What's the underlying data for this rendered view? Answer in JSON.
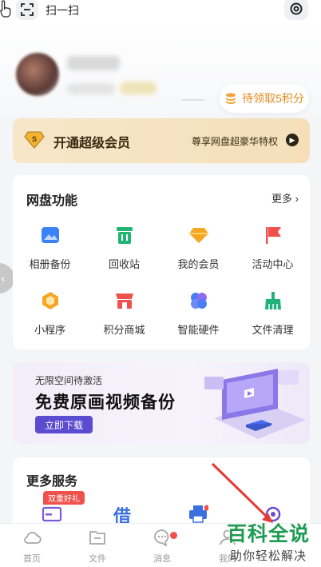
{
  "header": {
    "scan_label": "扫一扫"
  },
  "profile": {
    "points_label": "待领取5积分"
  },
  "vip": {
    "title": "开通超级会员",
    "subtitle": "尊享网盘超豪华特权",
    "badge_letter": "S"
  },
  "features": {
    "title": "网盘功能",
    "more_label": "更多",
    "items": [
      {
        "label": "相册备份",
        "icon": "photo-album-icon",
        "color": "#3b82f6"
      },
      {
        "label": "回收站",
        "icon": "trash-icon",
        "color": "#22b573"
      },
      {
        "label": "我的会员",
        "icon": "diamond-icon",
        "color": "#f5a623"
      },
      {
        "label": "活动中心",
        "icon": "flag-icon",
        "color": "#f0514c"
      },
      {
        "label": "小程序",
        "icon": "hexagon-icon",
        "color": "#f5a623"
      },
      {
        "label": "积分商城",
        "icon": "store-icon",
        "color": "#f0514c"
      },
      {
        "label": "智能硬件",
        "icon": "hardware-icon",
        "color": "#4a7ef6"
      },
      {
        "label": "文件清理",
        "icon": "broom-icon",
        "color": "#1fb27a"
      }
    ]
  },
  "banner": {
    "subtitle": "无限空间待激活",
    "title": "免费原画视频备份",
    "button_label": "立即下载"
  },
  "more_services": {
    "title": "更多服务",
    "badge": "双重好礼",
    "loan_glyph": "借"
  },
  "tabbar": {
    "items": [
      {
        "label": "首页",
        "icon": "cloud-icon"
      },
      {
        "label": "文件",
        "icon": "folder-icon"
      },
      {
        "label": "消息",
        "icon": "message-icon"
      },
      {
        "label": "我的",
        "icon": "user-icon"
      }
    ]
  },
  "watermark": {
    "title": "百科全说",
    "subtitle": "助你轻松解决"
  },
  "colors": {
    "accent": "#5b4bd1",
    "points": "#e58a1f",
    "vip_bg": "#f7e6c8",
    "red": "#f0514c"
  }
}
